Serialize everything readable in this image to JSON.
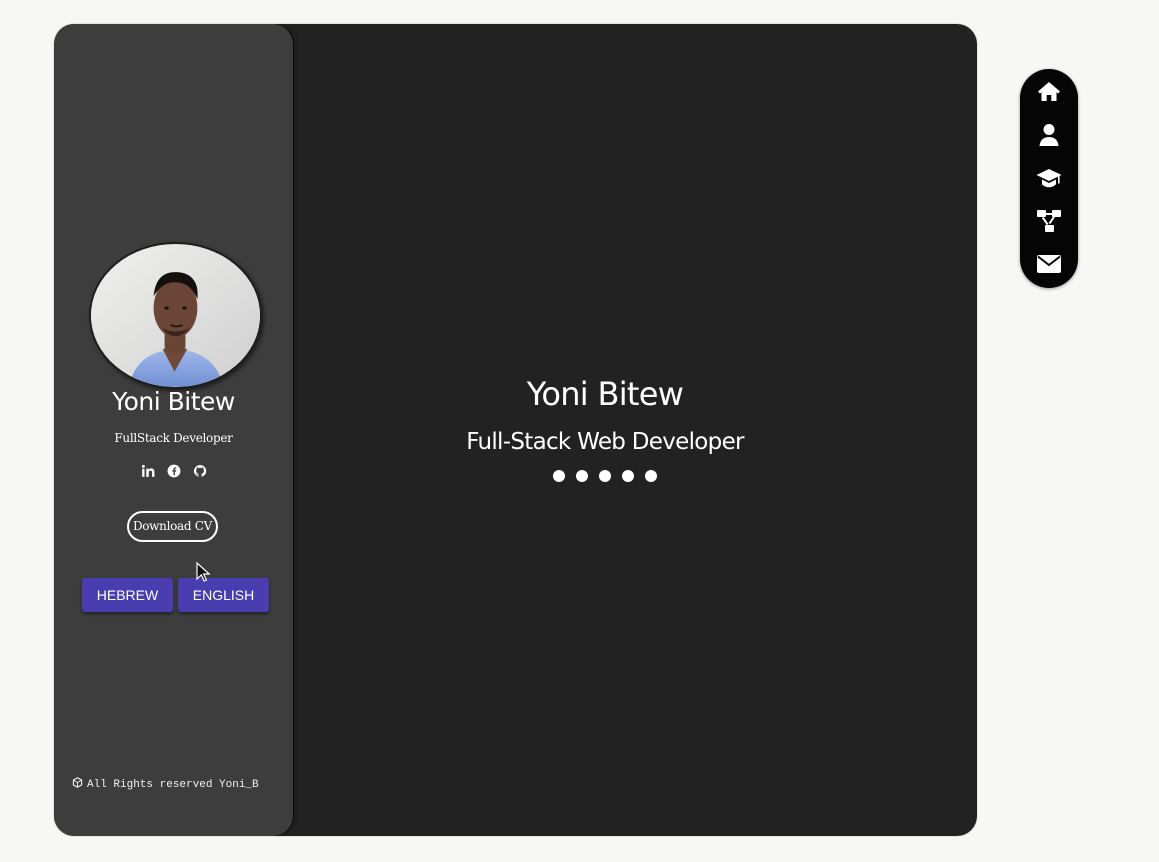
{
  "sidebar": {
    "name": "Yoni Bitew",
    "role": "FullStack Developer",
    "socials": [
      {
        "name": "linkedin",
        "icon": "linkedin-icon"
      },
      {
        "name": "facebook",
        "icon": "facebook-icon"
      },
      {
        "name": "github",
        "icon": "github-icon"
      }
    ],
    "download_cv_label": "Download CV",
    "language_buttons": {
      "hebrew": "HEBREW",
      "english": "ENGLISH"
    },
    "footer": "All Rights reserved Yoni_B",
    "footer_icon": "copyright-icon"
  },
  "hero": {
    "name": "Yoni Bitew",
    "role": "Full-Stack Web Developer",
    "loader_dots": 5
  },
  "right_nav": {
    "items": [
      {
        "name": "home",
        "icon": "home-icon"
      },
      {
        "name": "profile",
        "icon": "user-icon"
      },
      {
        "name": "education",
        "icon": "graduation-cap-icon"
      },
      {
        "name": "projects",
        "icon": "sitemap-icon"
      },
      {
        "name": "contact",
        "icon": "envelope-icon"
      }
    ]
  },
  "colors": {
    "page_background": "#f7f7f6",
    "main_panel": "#222222",
    "sidebar": "#3d3d3d",
    "language_button": "#4a3db0",
    "right_nav": "#050505",
    "text": "#ffffff"
  }
}
